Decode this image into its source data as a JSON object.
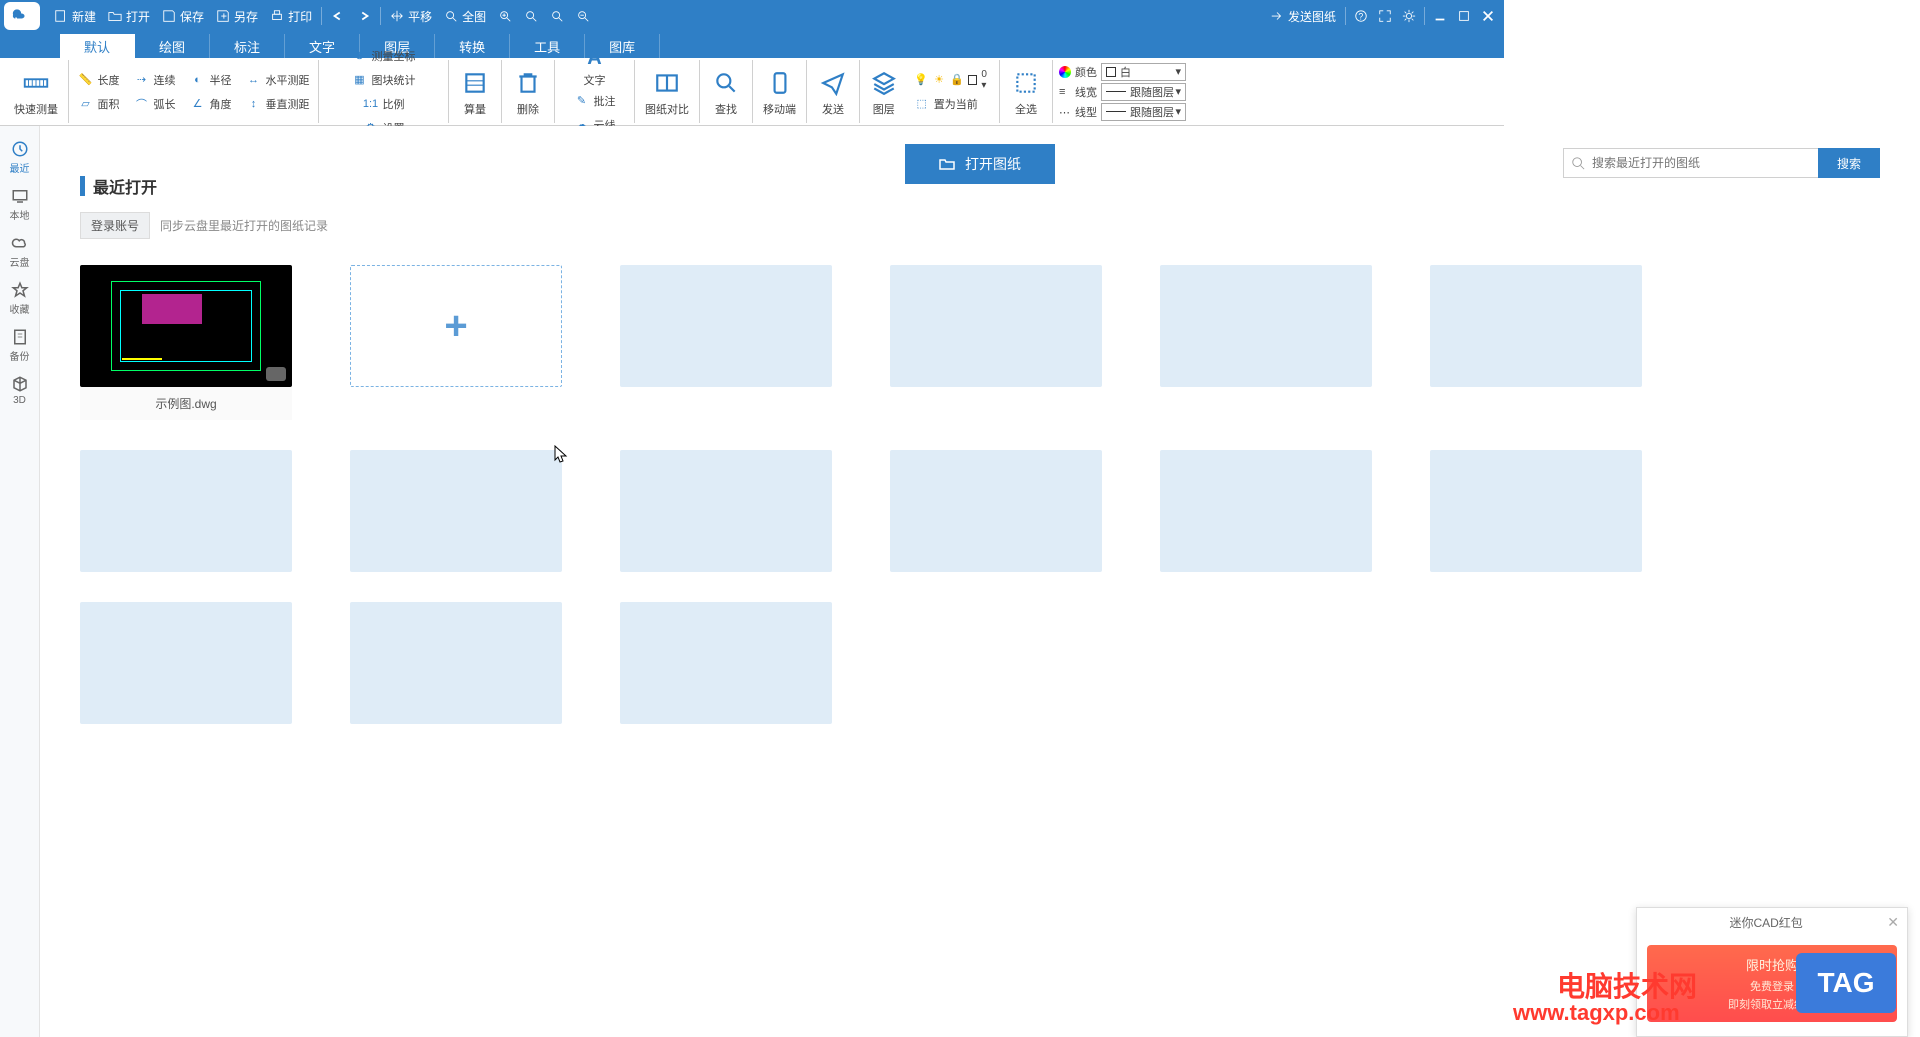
{
  "titlebar": {
    "items": [
      "新建",
      "打开",
      "保存",
      "另存",
      "打印"
    ],
    "nav": [
      "平移",
      "全图"
    ],
    "send": "发送图纸"
  },
  "menu": {
    "tabs": [
      "默认",
      "绘图",
      "标注",
      "文字",
      "图层",
      "转换",
      "工具",
      "图库"
    ]
  },
  "ribbon": {
    "quick_measure": "快速测量",
    "measure": {
      "length": "长度",
      "continuous": "连续",
      "radius": "半径",
      "hdist": "水平测距",
      "area": "面积",
      "arc": "弧长",
      "angle": "角度",
      "vdist": "垂直测距",
      "coord": "测量坐标",
      "ratio": "比例",
      "blockstat": "图块统计",
      "settings": "设置"
    },
    "calc": "算量",
    "delete": "删除",
    "text": "文字",
    "annotate": "批注",
    "cloud": "云线",
    "compare": "图纸对比",
    "find": "查找",
    "mobile": "移动端",
    "send": "发送",
    "layer": "图层",
    "set_current": "置为当前",
    "select_all": "全选",
    "props": {
      "color_label": "颜色",
      "color_value": "白",
      "lw_label": "线宽",
      "lw_value": "跟随图层",
      "lt_label": "线型",
      "lt_value": "跟随图层"
    }
  },
  "sidebar": {
    "items": [
      {
        "label": "最近"
      },
      {
        "label": "本地"
      },
      {
        "label": "云盘"
      },
      {
        "label": "收藏"
      },
      {
        "label": "备份"
      },
      {
        "label": "3D"
      }
    ]
  },
  "main": {
    "open_button": "打开图纸",
    "search_placeholder": "搜索最近打开的图纸",
    "search_button": "搜索",
    "section_title": "最近打开",
    "login_badge": "登录账号",
    "login_hint": "同步云盘里最近打开的图纸记录",
    "example_file": "示例图.dwg"
  },
  "popup": {
    "title": "迷你CAD红包",
    "line1": "限时抢购",
    "line2": "免费登录",
    "line3": "即刻领取立减红包"
  },
  "watermark": {
    "l1": "电脑技术网",
    "l2": "www.tagxp.com",
    "tag": "TAG"
  }
}
